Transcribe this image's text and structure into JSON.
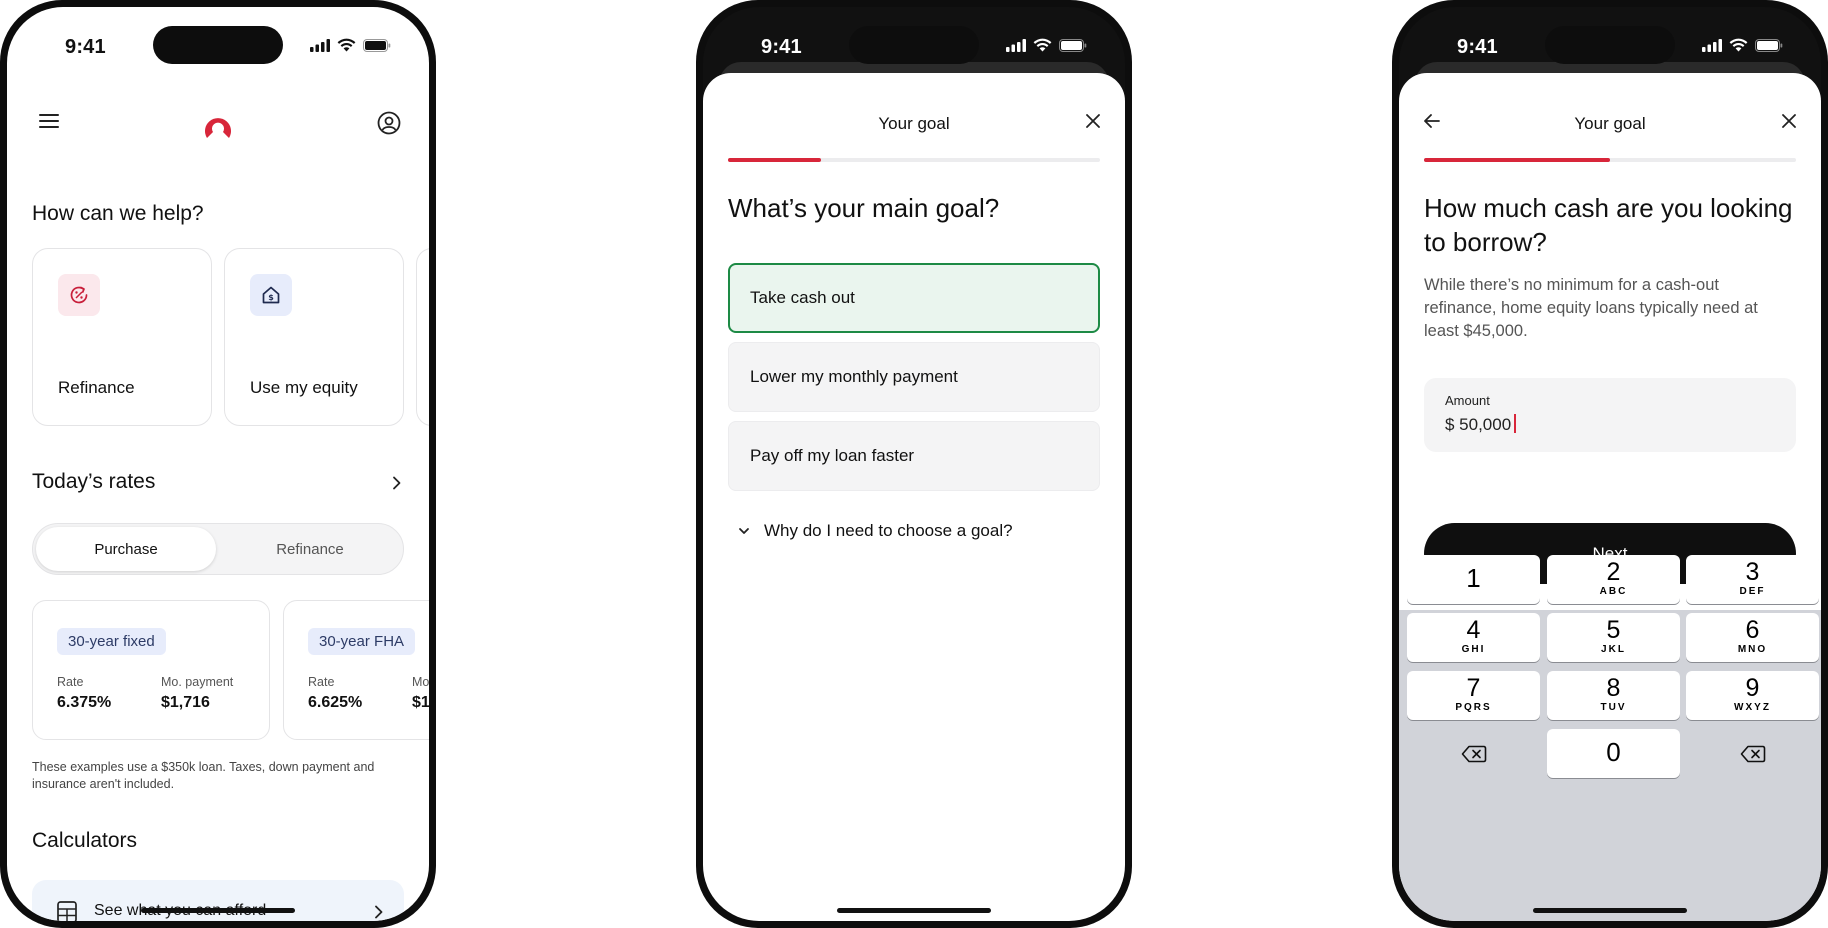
{
  "status": {
    "time": "9:41"
  },
  "phone1": {
    "section_help": "How can we help?",
    "help_cards": [
      {
        "label": "Refinance",
        "icon": "percent-refresh-icon"
      },
      {
        "label": "Use my equity",
        "icon": "house-dollar-icon"
      }
    ],
    "section_rates": "Today’s rates",
    "tabs": {
      "purchase": "Purchase",
      "refinance": "Refinance"
    },
    "rate_cards": [
      {
        "tag": "30-year fixed",
        "rate_label": "Rate",
        "rate": "6.375%",
        "payment_label": "Mo. payment",
        "payment": "$1,716"
      },
      {
        "tag": "30-year FHA",
        "rate_label": "Rate",
        "rate": "6.625%",
        "payment_label": "Mo",
        "payment": "$1"
      }
    ],
    "note": "These examples use a $350k loan. Taxes, down payment and insurance aren't included.",
    "section_calculators": "Calculators",
    "calculator_item": "See what you can afford",
    "colors": {
      "brand": "#d8263a"
    }
  },
  "phone2": {
    "title": "Your goal",
    "question": "What’s your main goal?",
    "options": [
      "Take cash out",
      "Lower my monthly payment",
      "Pay off my loan faster"
    ],
    "why": "Why do I need to choose a goal?",
    "progress": 0.25
  },
  "phone3": {
    "title": "Your goal",
    "question": "How much cash are you looking to borrow?",
    "description": "While there’s no minimum for a cash-out refinance, home equity loans typically need at least $45,000.",
    "amount_label": "Amount",
    "amount_value": "$ 50,000",
    "next": "Next",
    "progress": 0.5,
    "keys": [
      {
        "num": "1",
        "letters": ""
      },
      {
        "num": "2",
        "letters": "ABC"
      },
      {
        "num": "3",
        "letters": "DEF"
      },
      {
        "num": "4",
        "letters": "GHI"
      },
      {
        "num": "5",
        "letters": "JKL"
      },
      {
        "num": "6",
        "letters": "MNO"
      },
      {
        "num": "7",
        "letters": "PQRS"
      },
      {
        "num": "8",
        "letters": "TUV"
      },
      {
        "num": "9",
        "letters": "WXYZ"
      },
      {
        "num": "0",
        "letters": ""
      }
    ]
  }
}
